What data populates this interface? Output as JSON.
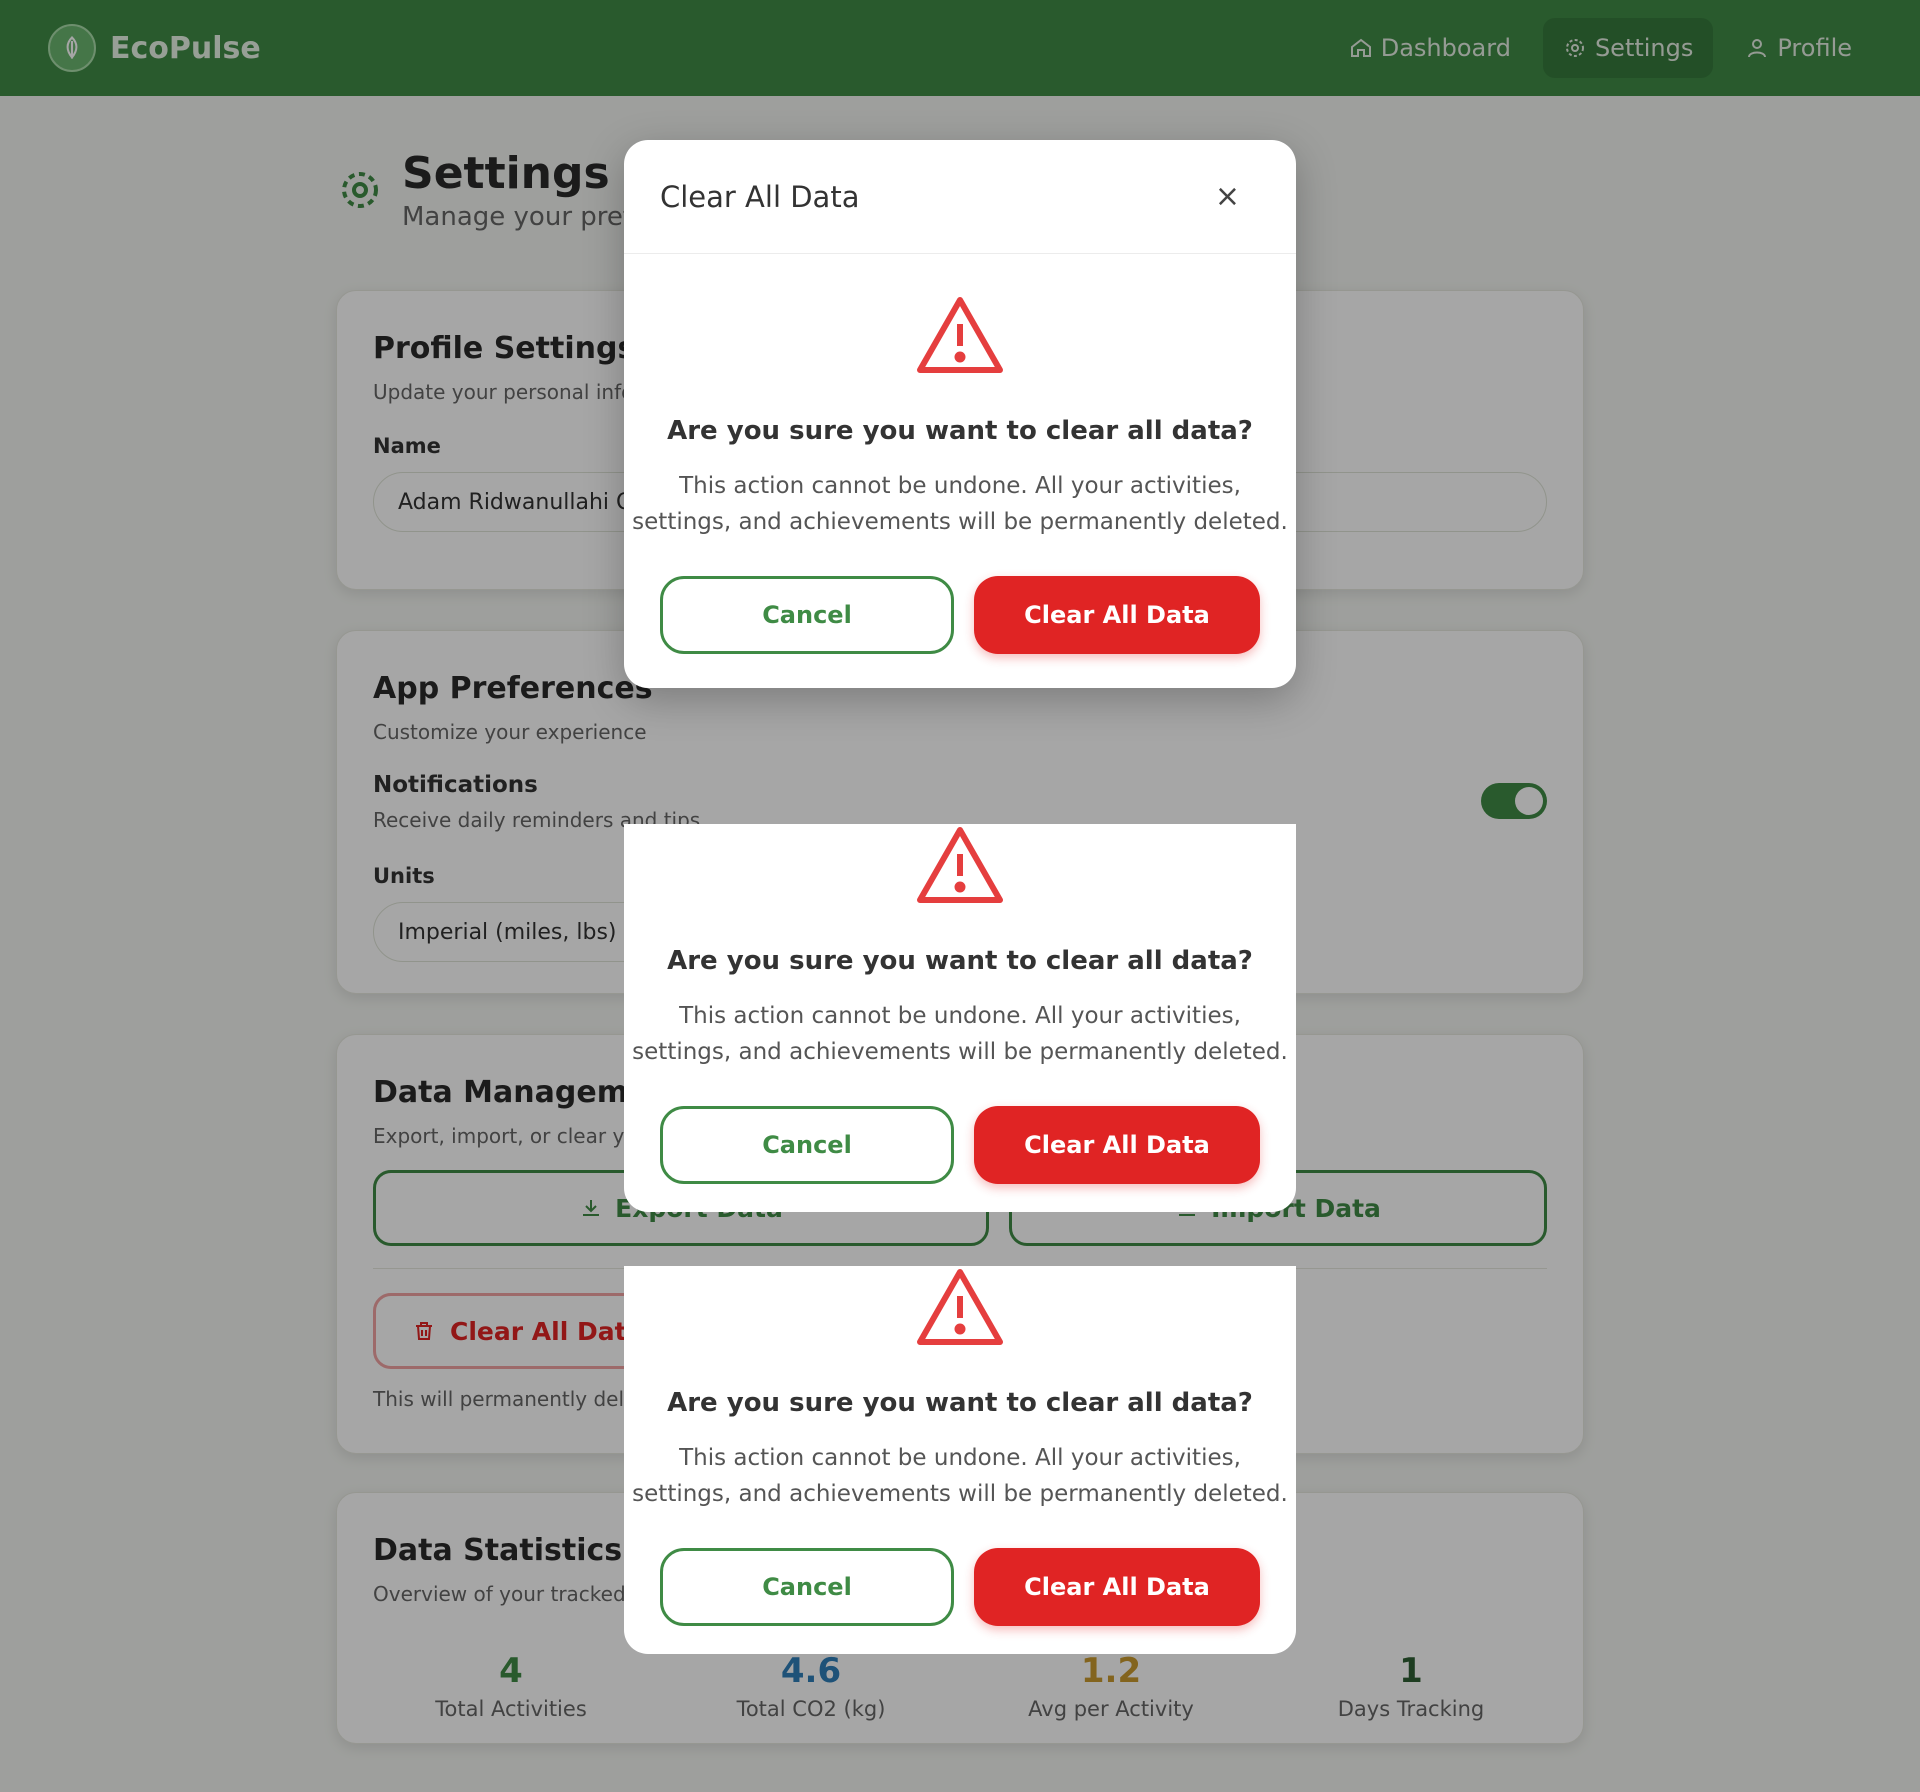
{
  "header": {
    "brand": "EcoPulse",
    "nav": [
      {
        "label": "Dashboard",
        "icon": "home-icon"
      },
      {
        "label": "Settings",
        "icon": "gear-icon"
      },
      {
        "label": "Profile",
        "icon": "user-icon"
      }
    ]
  },
  "page": {
    "title": "Settings",
    "subtitle": "Manage your prefe"
  },
  "profile": {
    "title": "Profile Settings",
    "subtitle": "Update your personal infor",
    "name_label": "Name",
    "name_value": "Adam Ridwanullahi O"
  },
  "prefs": {
    "title": "App Preferences",
    "subtitle": "Customize your experience",
    "notifications_label": "Notifications",
    "notifications_desc": "Receive daily reminders and tips",
    "notifications_on": true,
    "units_label": "Units",
    "units_value": "Imperial (miles, lbs)"
  },
  "data_mgmt": {
    "title": "Data Management",
    "subtitle": "Export, import, or clear you",
    "export_label": "Export Data",
    "import_label": "Import Data",
    "clear_label": "Clear All Data",
    "clear_note": "This will permanently delete"
  },
  "stats": {
    "title": "Data Statistics",
    "subtitle": "Overview of your tracked d",
    "items": [
      {
        "value": "4",
        "label": "Total Activities",
        "color": "#3f8b45"
      },
      {
        "value": "4.6",
        "label": "Total CO2 (kg)",
        "color": "#2f7fb8"
      },
      {
        "value": "1.2",
        "label": "Avg per Activity",
        "color": "#c99a2e"
      },
      {
        "value": "1",
        "label": "Days Tracking",
        "color": "#2f5f33"
      }
    ]
  },
  "modal": {
    "title": "Clear All Data",
    "close": "×",
    "question": "Are you sure you want to clear all data?",
    "desc_line1": "This action cannot be undone. All your activities,",
    "desc_line2": "settings, and achievements will be permanently deleted.",
    "cancel": "Cancel",
    "confirm": "Clear All Data"
  },
  "colors": {
    "primary": "#3f8b45",
    "danger": "#e02424"
  }
}
